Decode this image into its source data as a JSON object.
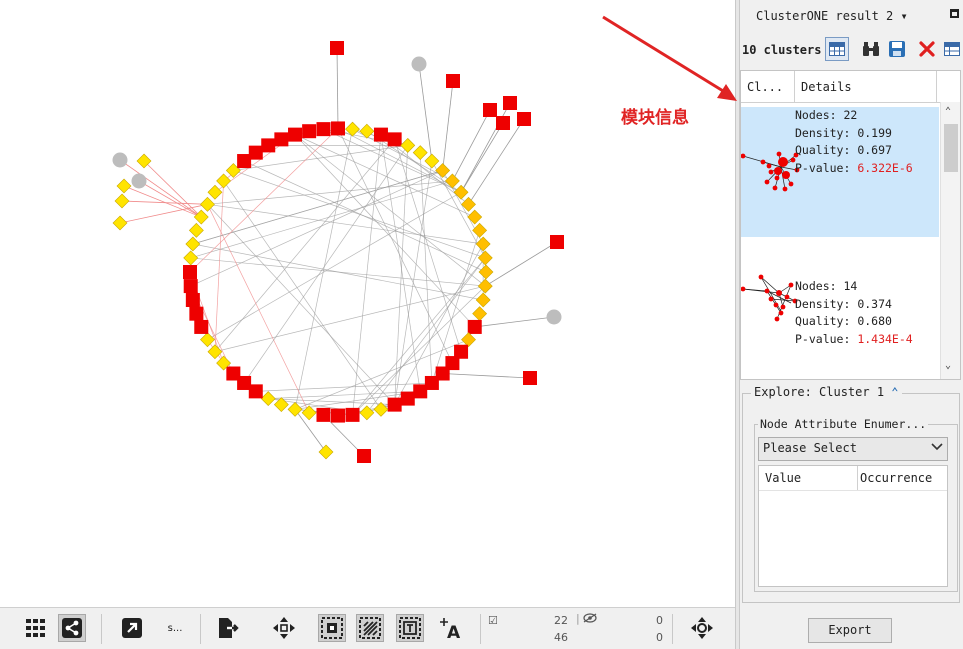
{
  "panel": {
    "title": "ClusterONE result 2 ▾",
    "clusters_label": "10 clusters",
    "icons": [
      "table-icon",
      "binoculars-icon",
      "save-icon",
      "close-icon",
      "table-icon"
    ],
    "table_headers": [
      "Cl...",
      "Details"
    ],
    "clusters": [
      {
        "nodes": "Nodes: 22",
        "density_label": "Density: ",
        "density": "0.199",
        "quality_label": "Quality: ",
        "quality": "0.697",
        "pvalue_label": "P-value: ",
        "pvalue": "6.322E-6",
        "selected": true
      },
      {
        "nodes": "Nodes: 14",
        "density_label": "Density: ",
        "density": "0.374",
        "quality_label": "Quality: ",
        "quality": "0.680",
        "pvalue_label": "P-value: ",
        "pvalue": "1.434E-4",
        "selected": false
      }
    ],
    "explore_title": "Explore: Cluster 1",
    "explore_icon": "double-chevron-up-icon",
    "nae_title": "Node Attribute Enumer...",
    "select_value": "Please Select",
    "enum_headers": [
      "Value",
      "Occurrence"
    ],
    "export_label": "Export"
  },
  "annotation": {
    "text": "模块信息",
    "color": "#e02424"
  },
  "toolbar": {
    "ellipsis_label": "s...",
    "selected_nodes": "22",
    "total_nodes": "46",
    "hidden_nodes": "0",
    "hidden_edges": "0"
  },
  "colors": {
    "accent_red": "#ee0000",
    "yellow": "#ffe400",
    "orange_yellow": "#ffbf00",
    "grey_node": "#bdbdbd",
    "selection_blue": "#cde7fb"
  }
}
